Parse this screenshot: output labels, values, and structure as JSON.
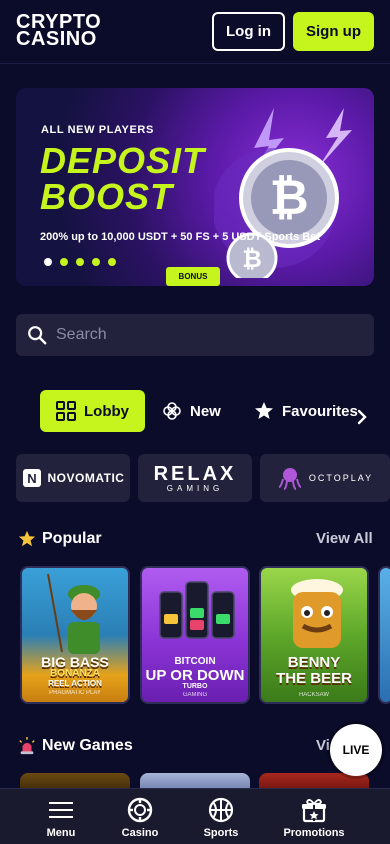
{
  "header": {
    "logo_line1": "CRYPTO",
    "logo_line2": "CASINO",
    "login_label": "Log in",
    "signup_label": "Sign up"
  },
  "banner": {
    "tag": "ALL NEW PLAYERS",
    "headline_1": "DEPOSIT",
    "headline_2": "BOOST",
    "description": "200% up to 10,000 USDT + 50 FS + 5 USDT Sports Bet",
    "button_label": "BONUS",
    "slide_count": 5,
    "active_slide": 1
  },
  "search": {
    "placeholder": "Search"
  },
  "tabs": [
    {
      "label": "Lobby",
      "icon": "grid-icon",
      "active": true
    },
    {
      "label": "New",
      "icon": "clover-icon",
      "active": false
    },
    {
      "label": "Favourites",
      "icon": "star-icon",
      "active": false
    }
  ],
  "providers": [
    {
      "name": "NOVOMATIC"
    },
    {
      "name": "RELAX",
      "sub": "GAMING"
    },
    {
      "name": "OCTOPLAY"
    }
  ],
  "popular": {
    "title": "Popular",
    "view_all": "View All",
    "games": [
      {
        "title_1": "BIG BASS",
        "title_2": "BONANZA",
        "title_3": "REEL ACTION",
        "provider": "PRAGMATIC PLAY"
      },
      {
        "title_1": "BITCOIN",
        "title_2": "UP OR DOWN",
        "title_3": "TURBO",
        "provider": "GAMING"
      },
      {
        "title_1": "BENNY",
        "title_2": "THE BEER",
        "title_3": "",
        "provider": "HACKSAW"
      }
    ]
  },
  "new_games": {
    "title": "New Games",
    "view_all": "Vi"
  },
  "live_badge": "LIVE",
  "bottom_nav": [
    {
      "label": "Menu",
      "icon": "menu-icon"
    },
    {
      "label": "Casino",
      "icon": "casino-chip-icon"
    },
    {
      "label": "Sports",
      "icon": "basketball-icon"
    },
    {
      "label": "Promotions",
      "icon": "gift-icon"
    }
  ],
  "colors": {
    "background": "#0b0b2a",
    "accent": "#c6f41d",
    "surface": "#22223c"
  }
}
